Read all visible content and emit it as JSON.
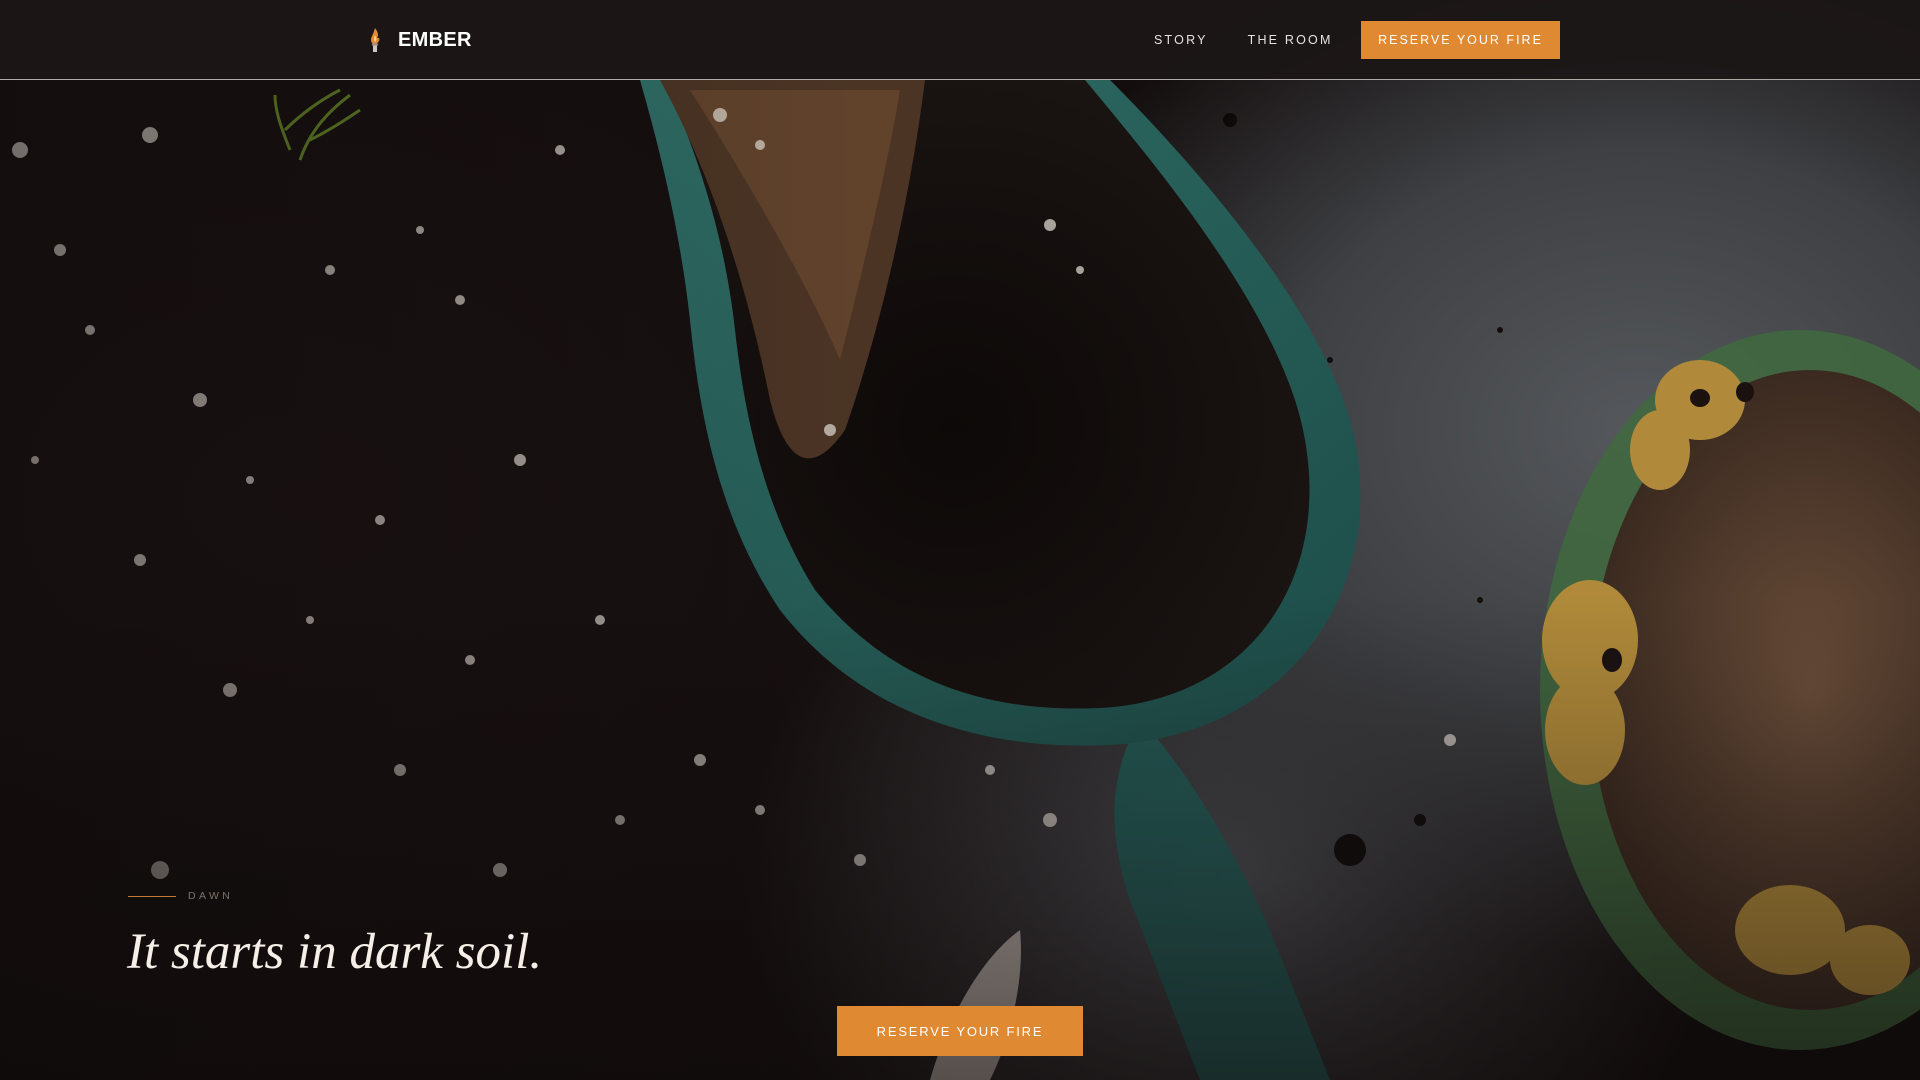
{
  "nav": {
    "brand": {
      "name": "EMBER",
      "icon": "flame-torch-icon"
    },
    "links": [
      {
        "label": "STORY"
      },
      {
        "label": "THE ROOM"
      }
    ],
    "cta_label": "RESERVE YOUR FIRE"
  },
  "hero": {
    "eyebrow": "DAWN",
    "headline": "It starts in dark soil.",
    "cta_label": "RESERVE YOUR FIRE",
    "background": "soil-scoop-photo"
  },
  "colors": {
    "accent": "#df8a33",
    "nav_bg": "#1c1616",
    "text_light": "#f5efe8"
  }
}
